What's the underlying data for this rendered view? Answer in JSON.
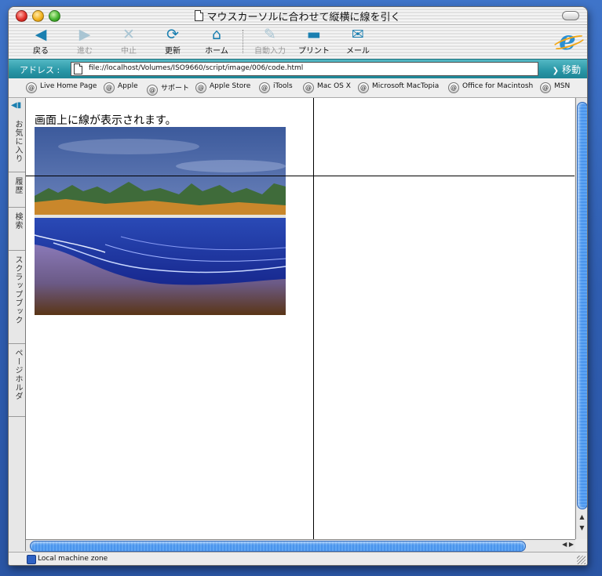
{
  "window": {
    "title": "マウスカーソルに合わせて縦横に線を引く"
  },
  "toolbar": {
    "buttons": [
      {
        "label": "戻る",
        "icon": "back-arrow-icon",
        "enabled": true
      },
      {
        "label": "進む",
        "icon": "forward-arrow-icon",
        "enabled": false
      },
      {
        "label": "中止",
        "icon": "stop-x-icon",
        "enabled": false
      },
      {
        "label": "更新",
        "icon": "refresh-icon",
        "enabled": true
      },
      {
        "label": "ホーム",
        "icon": "home-icon",
        "enabled": true
      },
      {
        "label": "自動入力",
        "icon": "autofill-icon",
        "enabled": false
      },
      {
        "label": "プリント",
        "icon": "printer-icon",
        "enabled": true
      },
      {
        "label": "メール",
        "icon": "mail-icon",
        "enabled": true
      }
    ]
  },
  "address": {
    "label": "アドレス :",
    "url": "file://localhost/Volumes/ISO9660/script/image/006/code.html",
    "go_label": "移動"
  },
  "links": [
    "Live Home Page",
    "Apple",
    "サポート",
    "Apple Store",
    "iTools",
    "Mac OS X",
    "Microsoft MacTopia",
    "Office for Macintosh",
    "MSN"
  ],
  "side_tabs": [
    "お気に入り",
    "履歴",
    "検索",
    "スクラップブック",
    "ページホルダ"
  ],
  "page": {
    "text": "画面上に線が表示されます。"
  },
  "status": {
    "zone": "Local machine zone"
  },
  "colors": {
    "accent": "#1a7fb0",
    "address_bar": "#2896a6",
    "scroll_thumb": "#4a94ec"
  }
}
